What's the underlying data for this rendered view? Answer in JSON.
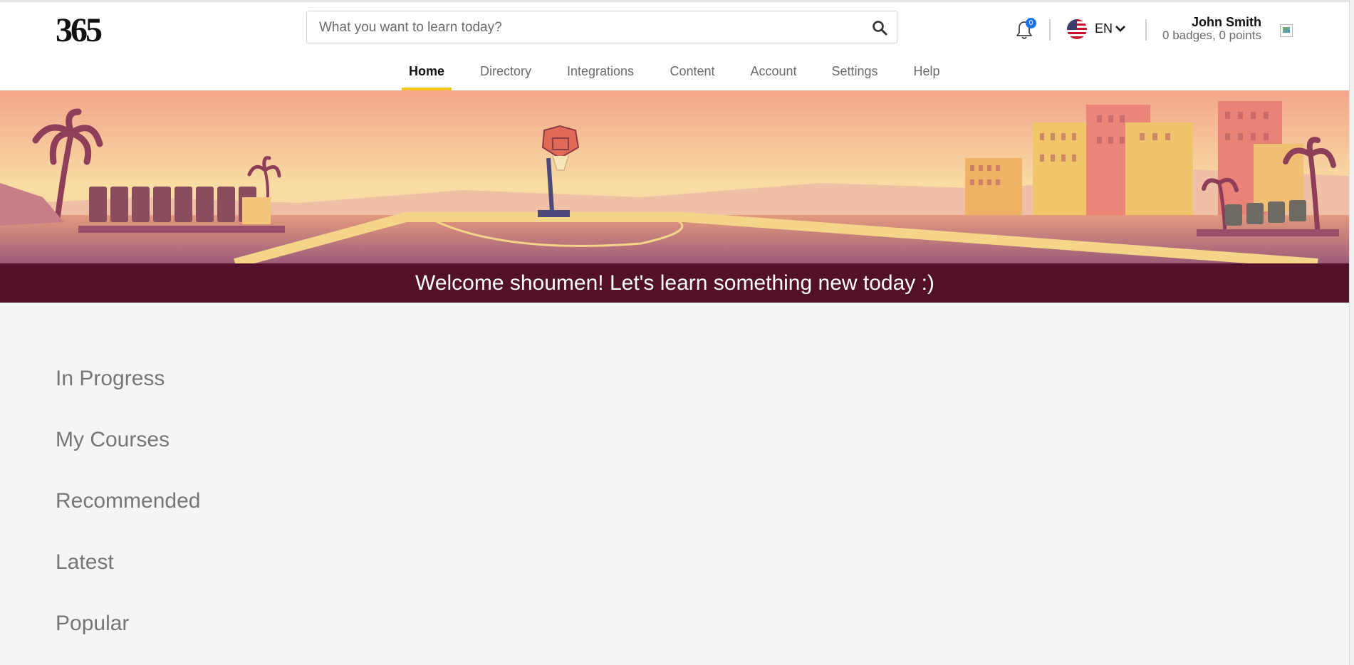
{
  "app": {
    "logo_text": "365"
  },
  "search": {
    "placeholder": "What you want to learn today?"
  },
  "notifications": {
    "count": "0"
  },
  "language": {
    "code": "EN",
    "flag_icon": "us-flag-icon"
  },
  "user": {
    "name": "John Smith",
    "meta": "0 badges, 0 points"
  },
  "nav": {
    "tabs": [
      {
        "label": "Home",
        "active": true
      },
      {
        "label": "Directory",
        "active": false
      },
      {
        "label": "Integrations",
        "active": false
      },
      {
        "label": "Content",
        "active": false
      },
      {
        "label": "Account",
        "active": false
      },
      {
        "label": "Settings",
        "active": false
      },
      {
        "label": "Help",
        "active": false
      }
    ]
  },
  "banner": {
    "welcome": "Welcome shoumen! Let's learn something new today :)"
  },
  "sections": [
    {
      "title": "In Progress"
    },
    {
      "title": "My Courses"
    },
    {
      "title": "Recommended"
    },
    {
      "title": "Latest"
    },
    {
      "title": "Popular"
    }
  ],
  "colors": {
    "accent": "#f5c518",
    "welcome_bg": "#521029",
    "badge": "#1a73e8"
  }
}
